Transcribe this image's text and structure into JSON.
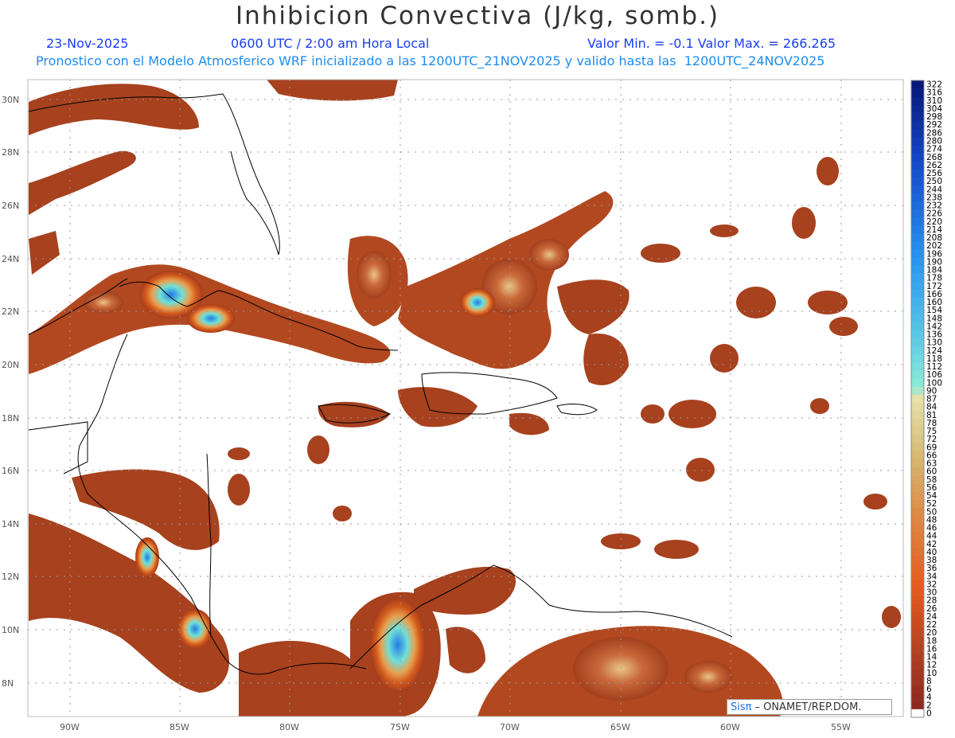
{
  "title": "Inhibicion Convectiva (J/kg, somb.)",
  "header": {
    "date": "23-Nov-2025",
    "time": "0600 UTC / 2:00 am Hora Local",
    "minmax": "Valor Min. = -0.1  Valor Max. = 266.265",
    "subtitle": "Pronostico con el Modelo Atmosferico WRF inicializado a las 1200UTC_21NOV2025 y valido hasta las  1200UTC_24NOV2025"
  },
  "lat_labels": [
    "30N",
    "28N",
    "26N",
    "24N",
    "22N",
    "20N",
    "18N",
    "16N",
    "14N",
    "12N",
    "10N",
    "8N"
  ],
  "lon_labels": [
    "90W",
    "85W",
    "80W",
    "75W",
    "70W",
    "65W",
    "60W",
    "55W"
  ],
  "colorbar": {
    "labels": [
      "322",
      "316",
      "310",
      "304",
      "298",
      "292",
      "286",
      "280",
      "274",
      "268",
      "262",
      "256",
      "250",
      "244",
      "238",
      "232",
      "226",
      "220",
      "214",
      "208",
      "202",
      "196",
      "190",
      "184",
      "178",
      "172",
      "166",
      "160",
      "154",
      "148",
      "142",
      "136",
      "130",
      "124",
      "118",
      "112",
      "106",
      "100",
      "90",
      "87",
      "84",
      "81",
      "78",
      "75",
      "72",
      "69",
      "66",
      "63",
      "60",
      "58",
      "56",
      "54",
      "52",
      "50",
      "48",
      "46",
      "44",
      "42",
      "40",
      "38",
      "36",
      "34",
      "32",
      "30",
      "28",
      "26",
      "24",
      "22",
      "20",
      "18",
      "16",
      "14",
      "12",
      "10",
      "8",
      "6",
      "4",
      "2",
      "0"
    ]
  },
  "credit": {
    "logo": "Sisπ",
    "text": "– ONAMET/REP.DOM."
  },
  "colors": {
    "accent_blue": "#1a3ef0",
    "cyan": "#1e8cf0",
    "field": "#a7411e"
  }
}
